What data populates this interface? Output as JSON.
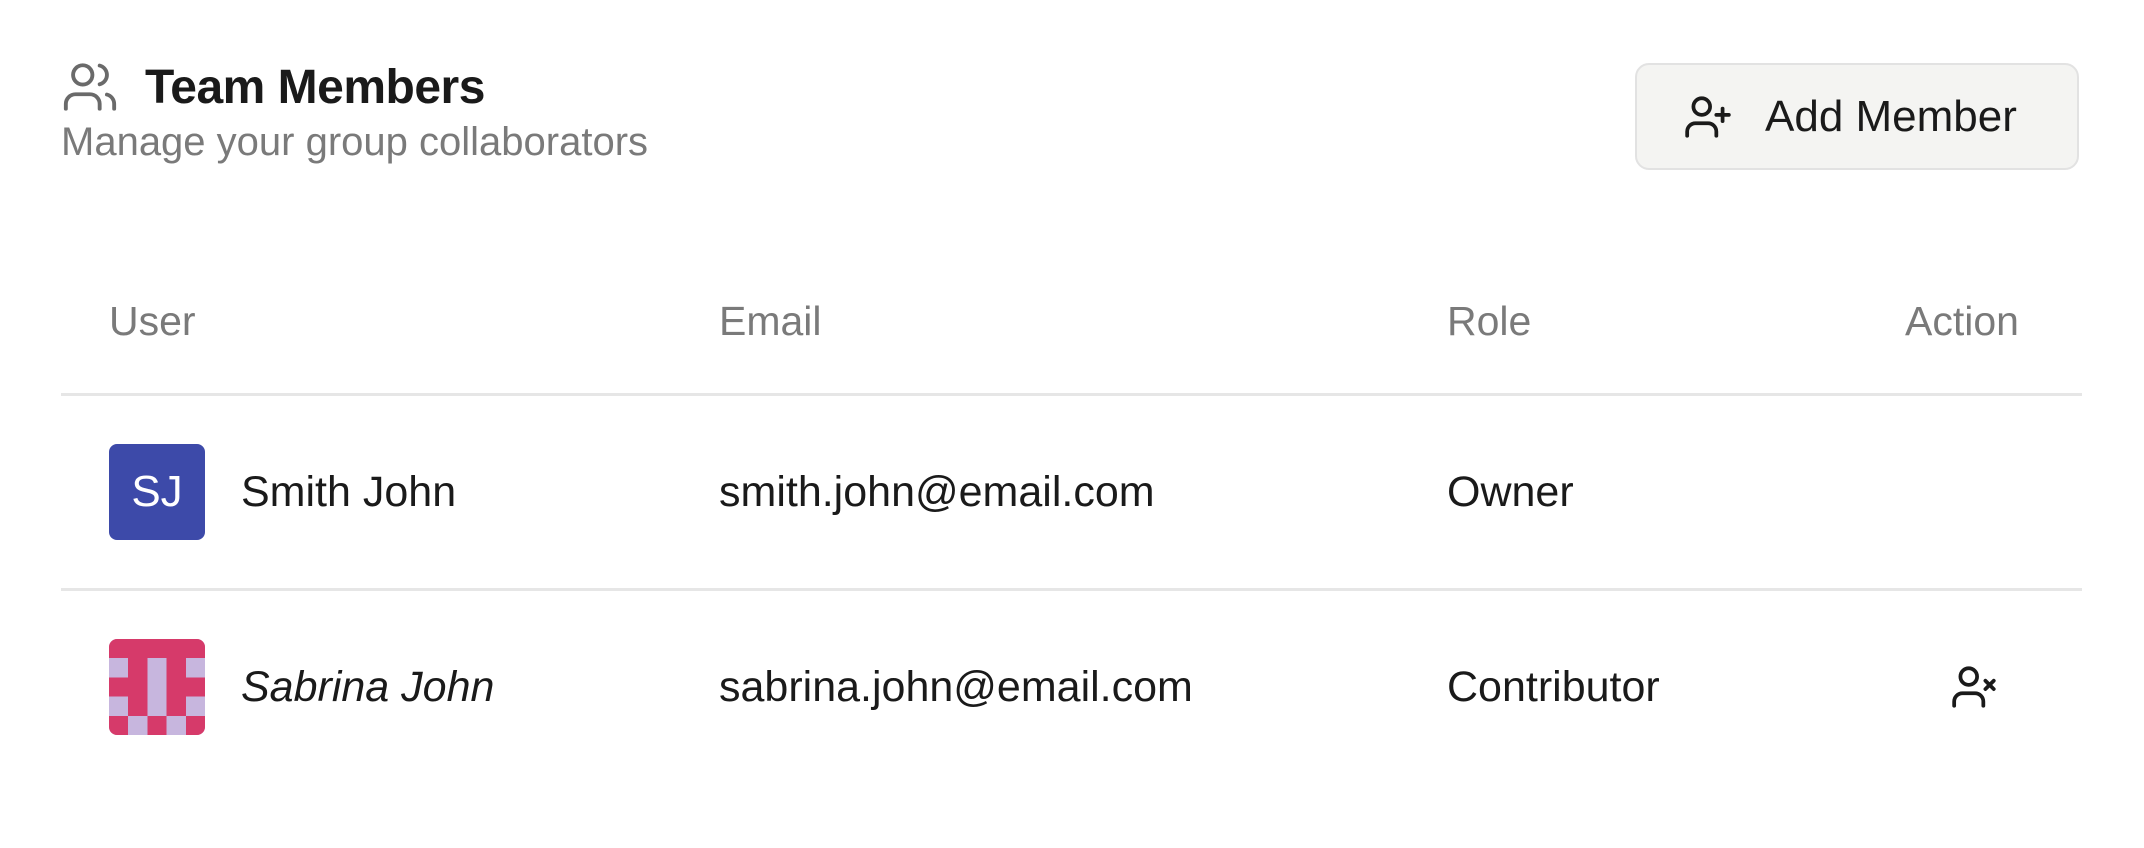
{
  "header": {
    "title": "Team Members",
    "subtitle": "Manage your group collaborators",
    "title_icon": "users-icon"
  },
  "add_button": {
    "label": "Add Member",
    "icon": "user-plus-icon"
  },
  "table": {
    "columns": [
      "User",
      "Email",
      "Role",
      "Action"
    ],
    "rows": [
      {
        "initials": "SJ",
        "avatar_type": "initials",
        "avatar_color": "#3d4aa9",
        "name": "Smith John",
        "email": "smith.john@email.com",
        "role": "Owner",
        "action": null
      },
      {
        "avatar_type": "identicon",
        "avatar_colors": [
          "#d63a6a",
          "#c7b6de"
        ],
        "name": "Sabrina John",
        "email": "sabrina.john@email.com",
        "role": "Contributor",
        "action": "user-remove-icon"
      }
    ]
  }
}
